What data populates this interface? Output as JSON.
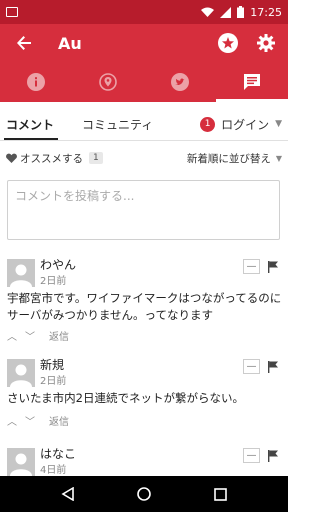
{
  "status_bar": {
    "time": "17:25"
  },
  "app_bar": {
    "title": "Au"
  },
  "tabs": [
    {
      "icon": "info-icon",
      "active": false
    },
    {
      "icon": "location-pin-icon",
      "active": false
    },
    {
      "icon": "twitter-icon",
      "active": false
    },
    {
      "icon": "comment-icon",
      "active": true
    }
  ],
  "subnav": {
    "tab_comment": "コメント",
    "tab_community": "コミュニティ",
    "login_badge": "1",
    "login_label": "ログイン"
  },
  "filter": {
    "recommend_label": "オススメする",
    "recommend_count": "1",
    "sort_label": "新着順に並び替え"
  },
  "comment_input": {
    "placeholder": "コメントを投稿する..."
  },
  "comments": [
    {
      "author": "わやん",
      "time": "2日前",
      "body": "宇都宮市です。ワイファイマークはつながってるのにサーバがみつかりません。ってなります",
      "reply_label": "返信"
    },
    {
      "author": "新規",
      "time": "2日前",
      "body": "さいたま市内2日連続でネットが繋がらない。",
      "reply_label": "返信"
    },
    {
      "author": "はなこ",
      "time": "4日前",
      "body": "",
      "reply_label": ""
    }
  ],
  "colors": {
    "primary": "#d62e3d",
    "status": "#b71c2c"
  }
}
